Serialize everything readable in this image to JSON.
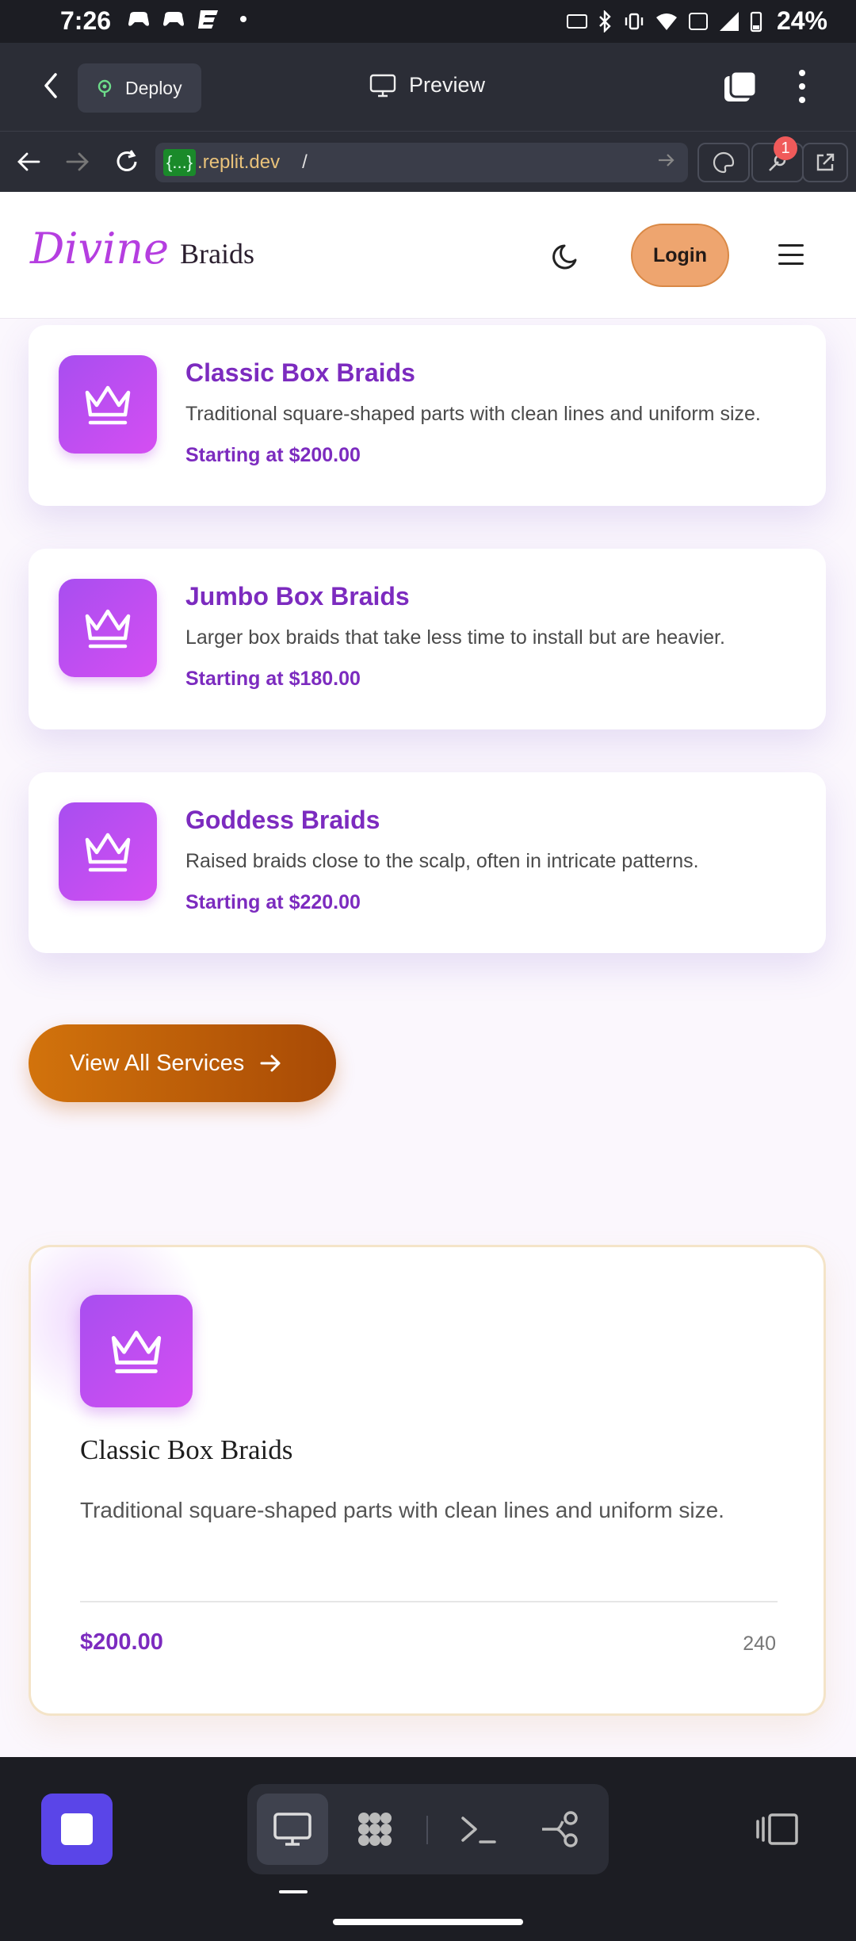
{
  "status_bar": {
    "time": "7:26",
    "battery": "24%"
  },
  "toolbar": {
    "deploy_label": "Deploy",
    "preview_label": "Preview"
  },
  "url_bar": {
    "braces": "{...}",
    "domain": ".replit.dev",
    "path": "/",
    "badge_count": "1"
  },
  "site": {
    "logo_script": "Divine",
    "logo_word": "Braids",
    "login_label": "Login"
  },
  "services": [
    {
      "name": "Classic Box Braids",
      "description": "Traditional square-shaped parts with clean lines and uniform size.",
      "price": "Starting at $200.00"
    },
    {
      "name": "Jumbo Box Braids",
      "description": "Larger box braids that take less time to install but are heavier.",
      "price": "Starting at $180.00"
    },
    {
      "name": "Goddess Braids",
      "description": "Raised braids close to the scalp, often in intricate patterns.",
      "price": "Starting at $220.00"
    }
  ],
  "view_all_label": "View All Services",
  "featured": {
    "name": "Classic Box Braids",
    "description": "Traditional square-shaped parts with clean lines and uniform size.",
    "price": "$200.00",
    "duration": "240"
  },
  "colors": {
    "accent_purple": "#7c2bbf",
    "icon_gradient_start": "#a84ef0",
    "cta_orange": "#d2730c",
    "login_bg": "#eea56f",
    "ide_dark": "#1c1d23"
  },
  "icons": [
    "back-arrow-icon",
    "deploy-icon",
    "monitor-icon",
    "copy-icon",
    "more-vert-icon",
    "crown-icon",
    "moon-icon",
    "menu-icon",
    "arrow-right-icon",
    "stop-icon",
    "monitor-icon",
    "extensions-icon",
    "terminal-icon",
    "git-branch-icon",
    "panel-icon"
  ]
}
